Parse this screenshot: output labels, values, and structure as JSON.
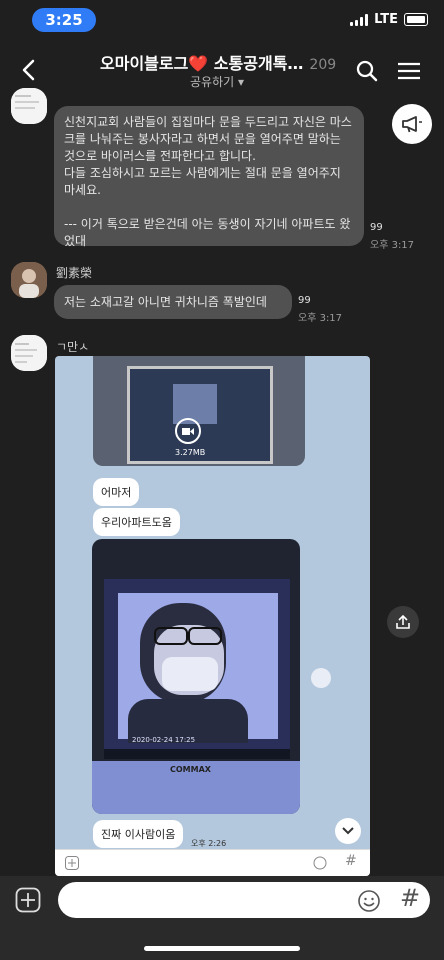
{
  "status_bar": {
    "time": "3:25",
    "network": "LTE"
  },
  "header": {
    "title": "오마이블로그❤️ 소통공개톡…",
    "member_count": "209",
    "share_label": "공유하기 ▾"
  },
  "messages": [
    {
      "sender": "",
      "text": "신천지교회 사람들이 집집마다 문을 두드리고 자신은 마스크를 나눠주는 봉사자라고 하면서 문을 열어주면 말하는 것으로 바이러스를 전파한다고 합니다.\n다들 조심하시고 모르는 사람에게는 절대 문을 열어주지 마세요.\n\n--- 이거 톡으로 받은건데 아는 동생이 자기네 아파트도 왔었대",
      "read_count": "99",
      "time": "오후 3:17"
    },
    {
      "sender": "劉素榮",
      "text": "저는 소재고갈 아니면 귀차니즘 폭발인데",
      "read_count": "99",
      "time": "오후 3:17"
    },
    {
      "sender": "ㄱ만ㅅ",
      "image": {
        "video_size": "3.27MB",
        "bubbles": [
          "어마저",
          "우리아파트도옴",
          "진짜 이사람이옴"
        ],
        "bubble_time": "오후 2:26",
        "intercom_timestamp": "2020-02-24 17:25",
        "intercom_brand": "COMMAX"
      }
    }
  ],
  "colors": {
    "accent": "#2f7cf6",
    "bubble": "#515151",
    "background": "#1f1f1f"
  },
  "icons": [
    "back-icon",
    "heart-icon",
    "search-icon",
    "menu-icon",
    "megaphone-icon",
    "share-icon",
    "chevron-down-icon",
    "plus-icon",
    "emoji-icon",
    "hash-icon"
  ]
}
